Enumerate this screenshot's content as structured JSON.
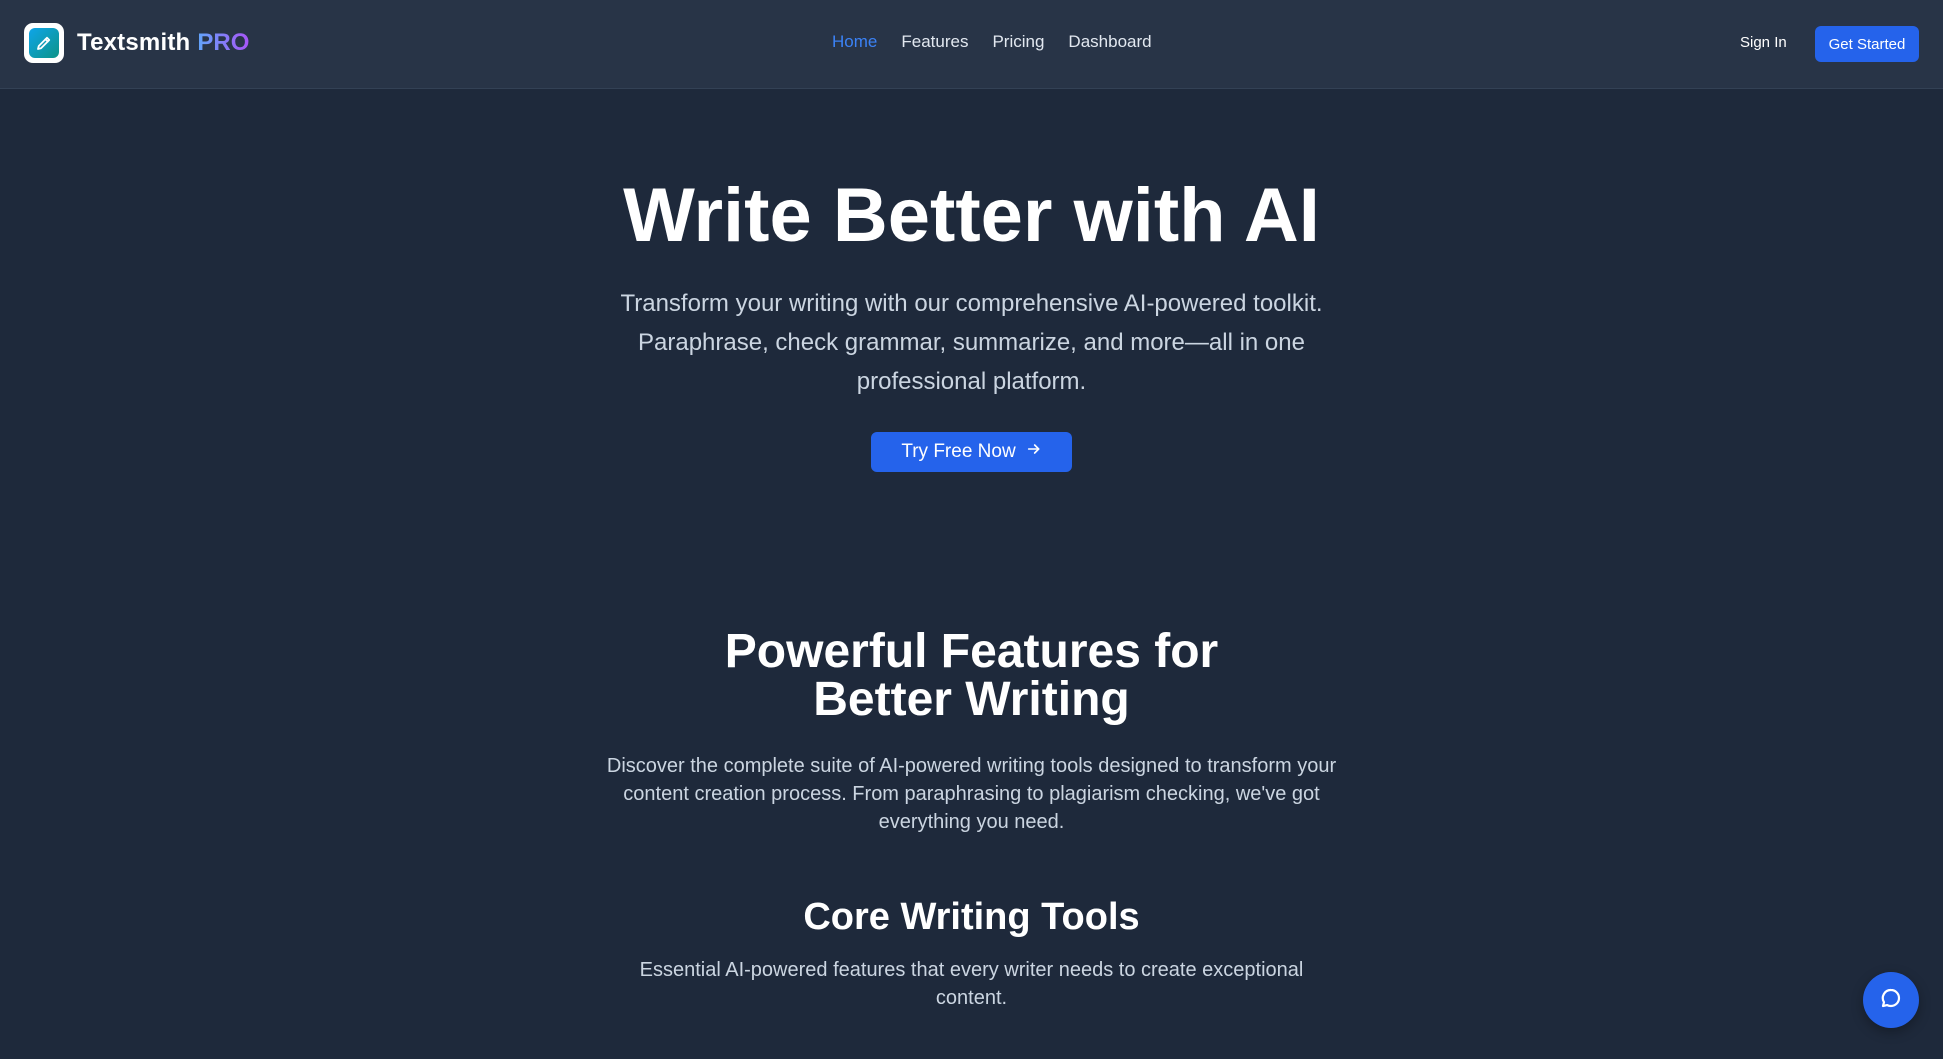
{
  "brand": {
    "name": "Textsmith",
    "badge": "PRO",
    "logo_icon": "pencil-icon"
  },
  "nav": {
    "links": [
      {
        "label": "Home",
        "active": true
      },
      {
        "label": "Features",
        "active": false
      },
      {
        "label": "Pricing",
        "active": false
      },
      {
        "label": "Dashboard",
        "active": false
      }
    ],
    "sign_in_label": "Sign In",
    "get_started_label": "Get Started"
  },
  "hero": {
    "title": "Write Better with AI",
    "subtitle": "Transform your writing with our comprehensive AI-powered toolkit. Paraphrase, check grammar, summarize, and more—all in one professional platform.",
    "cta_label": "Try Free Now",
    "cta_icon": "arrow-right-icon"
  },
  "features": {
    "title": "Powerful Features for Better Writing",
    "subtitle": "Discover the complete suite of AI-powered writing tools designed to transform your content creation process. From paraphrasing to plagiarism checking, we've got everything you need."
  },
  "core": {
    "title": "Core Writing Tools",
    "subtitle": "Essential AI-powered features that every writer needs to create exceptional content."
  },
  "chat": {
    "icon": "chat-bubble-icon"
  },
  "colors": {
    "background": "#1e293b",
    "navbar": "#283447",
    "accent": "#2563eb",
    "active_link": "#3b82f6",
    "muted_text": "#cbd5e1"
  }
}
